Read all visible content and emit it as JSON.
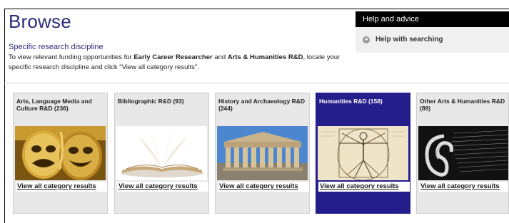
{
  "page": {
    "title": "Browse",
    "subtitle": "Specific research discipline",
    "description": {
      "part1": "To view relevant funding opportunities for ",
      "bold1": "Early Career Researcher",
      "part2": " and ",
      "bold2": "Arts & Humanities R&D",
      "part3": ", locate your specific research discipline and click \"View all category results\"."
    }
  },
  "help": {
    "heading": "Help and advice",
    "item": "Help with searching",
    "item_icon": "arrow-icon"
  },
  "categories": [
    {
      "name": "Arts, Language Media and Culture R&D (236)",
      "link": "View all category results",
      "image": "theatre-masks"
    },
    {
      "name": "Bibliographic R&D (93)",
      "link": "View all category results",
      "image": "open-book"
    },
    {
      "name": "History and Archaeology R&D (244)",
      "link": "View all category results",
      "image": "parthenon"
    },
    {
      "name": "Humanities R&D (158)",
      "link": "View all category results",
      "image": "vitruvian-man",
      "selected": true
    },
    {
      "name": "Other Arts & Humanities R&D (89)",
      "link": "View all category results",
      "image": "text-ear"
    }
  ],
  "colors": {
    "title": "#2b2b7a",
    "selected_card": "#241e8c",
    "help_header": "#000000"
  }
}
